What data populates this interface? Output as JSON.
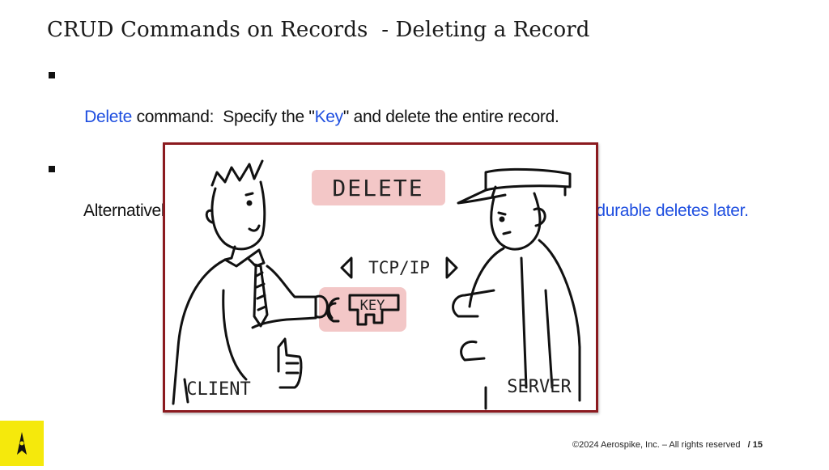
{
  "slide": {
    "title": "CRUD Commands on Records  - Deleting a Record",
    "bullets": [
      {
        "parts": [
          {
            "text": "Delete",
            "style": "blue"
          },
          {
            "text": " command:  Specify the \"",
            "style": "plain"
          },
          {
            "text": "Key",
            "style": "blue"
          },
          {
            "text": "\" and delete the entire record.",
            "style": "plain"
          }
        ]
      },
      {
        "parts": [
          {
            "text": "Alternatively, ",
            "style": "plain"
          },
          {
            "text": "delete durably, leaving a tombstone behind.  Will explore durable deletes later.",
            "style": "blue"
          }
        ]
      }
    ]
  },
  "illustration": {
    "delete_label": "DELETE",
    "protocol_label": "TCP/IP",
    "key_label": "KEY",
    "client_label": "CLIENT",
    "server_label": "SERVER",
    "highlight_color": "#f3c7c7",
    "border_color": "#8b1a1f"
  },
  "footer": {
    "copyright": "©2024 Aerospike, Inc. – All rights reserved",
    "page_number": "/ 15"
  },
  "colors": {
    "accent_blue": "#1f4fe0",
    "logo_yellow": "#f5e90c"
  }
}
